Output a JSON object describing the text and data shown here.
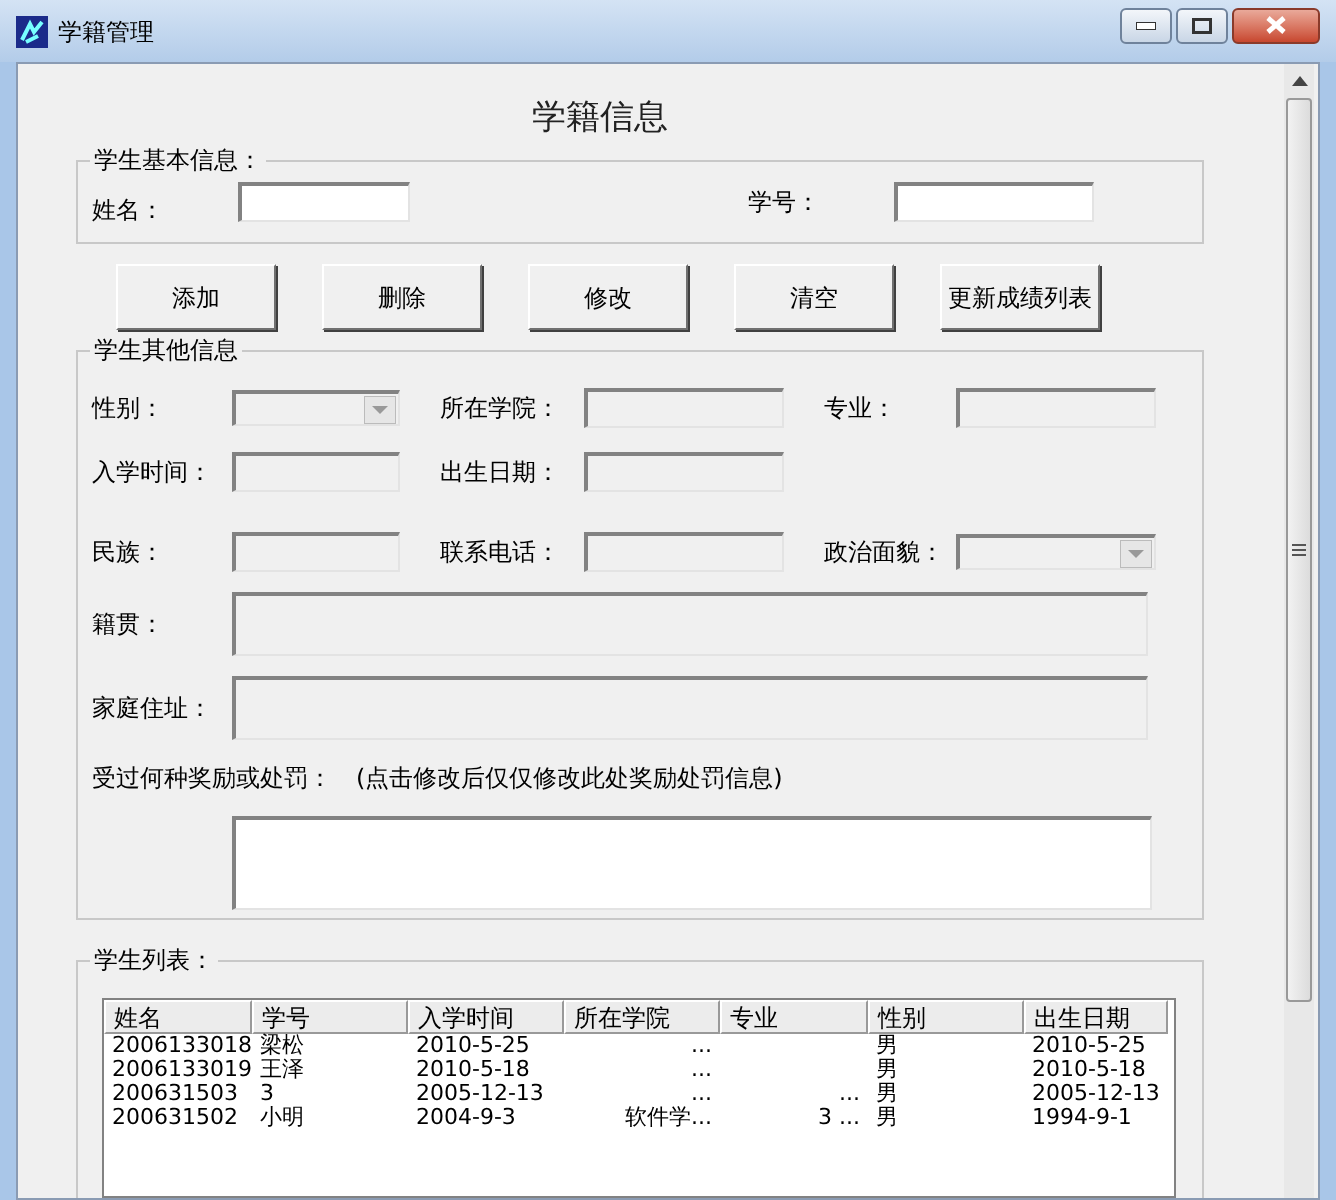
{
  "window": {
    "title": "学籍管理"
  },
  "heading": "学籍信息",
  "basic_info": {
    "legend": "学生基本信息：",
    "fields": [
      {
        "label": "姓名：",
        "kind": "text",
        "disabled": false
      },
      {
        "label": "学号：",
        "kind": "text",
        "disabled": false
      }
    ]
  },
  "buttons": [
    "添加",
    "删除",
    "修改",
    "清空",
    "更新成绩列表"
  ],
  "other_info": {
    "legend": "学生其他信息",
    "rows": [
      [
        {
          "label": "性别：",
          "kind": "combo",
          "disabled": true
        },
        {
          "label": "所在学院：",
          "kind": "text",
          "disabled": true
        },
        {
          "label": "专业：",
          "kind": "text",
          "disabled": true
        }
      ],
      [
        {
          "label": "入学时间：",
          "kind": "text",
          "disabled": true
        },
        {
          "label": "出生日期：",
          "kind": "text",
          "disabled": true
        }
      ],
      [
        {
          "label": "民族：",
          "kind": "text",
          "disabled": true
        },
        {
          "label": "联系电话：",
          "kind": "text",
          "disabled": true
        },
        {
          "label": "政治面貌：",
          "kind": "combo",
          "disabled": true
        }
      ],
      [
        {
          "label": "籍贯：",
          "kind": "wide",
          "disabled": true
        }
      ],
      [
        {
          "label": "家庭住址：",
          "kind": "wide",
          "disabled": true
        }
      ]
    ],
    "reward": {
      "label": "受过何种奖励或处罚：",
      "note": "(点击修改后仅仅修改此处奖励处罚信息)",
      "disabled": false
    }
  },
  "student_list": {
    "legend": "学生列表：",
    "columns": [
      "姓名",
      "学号",
      "入学时间",
      "所在学院",
      "专业",
      "性别",
      "出生日期"
    ],
    "rows": [
      [
        "2006133018",
        "梁松",
        "2010-5-25",
        "...",
        "",
        "男",
        "2010-5-25"
      ],
      [
        "2006133019",
        "王泽",
        "2010-5-18",
        "...",
        "",
        "男",
        "2010-5-18"
      ],
      [
        "200631503",
        "3",
        "2005-12-13",
        "...",
        "...",
        "男",
        "2005-12-13"
      ],
      [
        "200631502",
        "小明",
        "2004-9-3",
        "软件学...",
        "3 ...",
        "男",
        "1994-9-1"
      ]
    ]
  }
}
